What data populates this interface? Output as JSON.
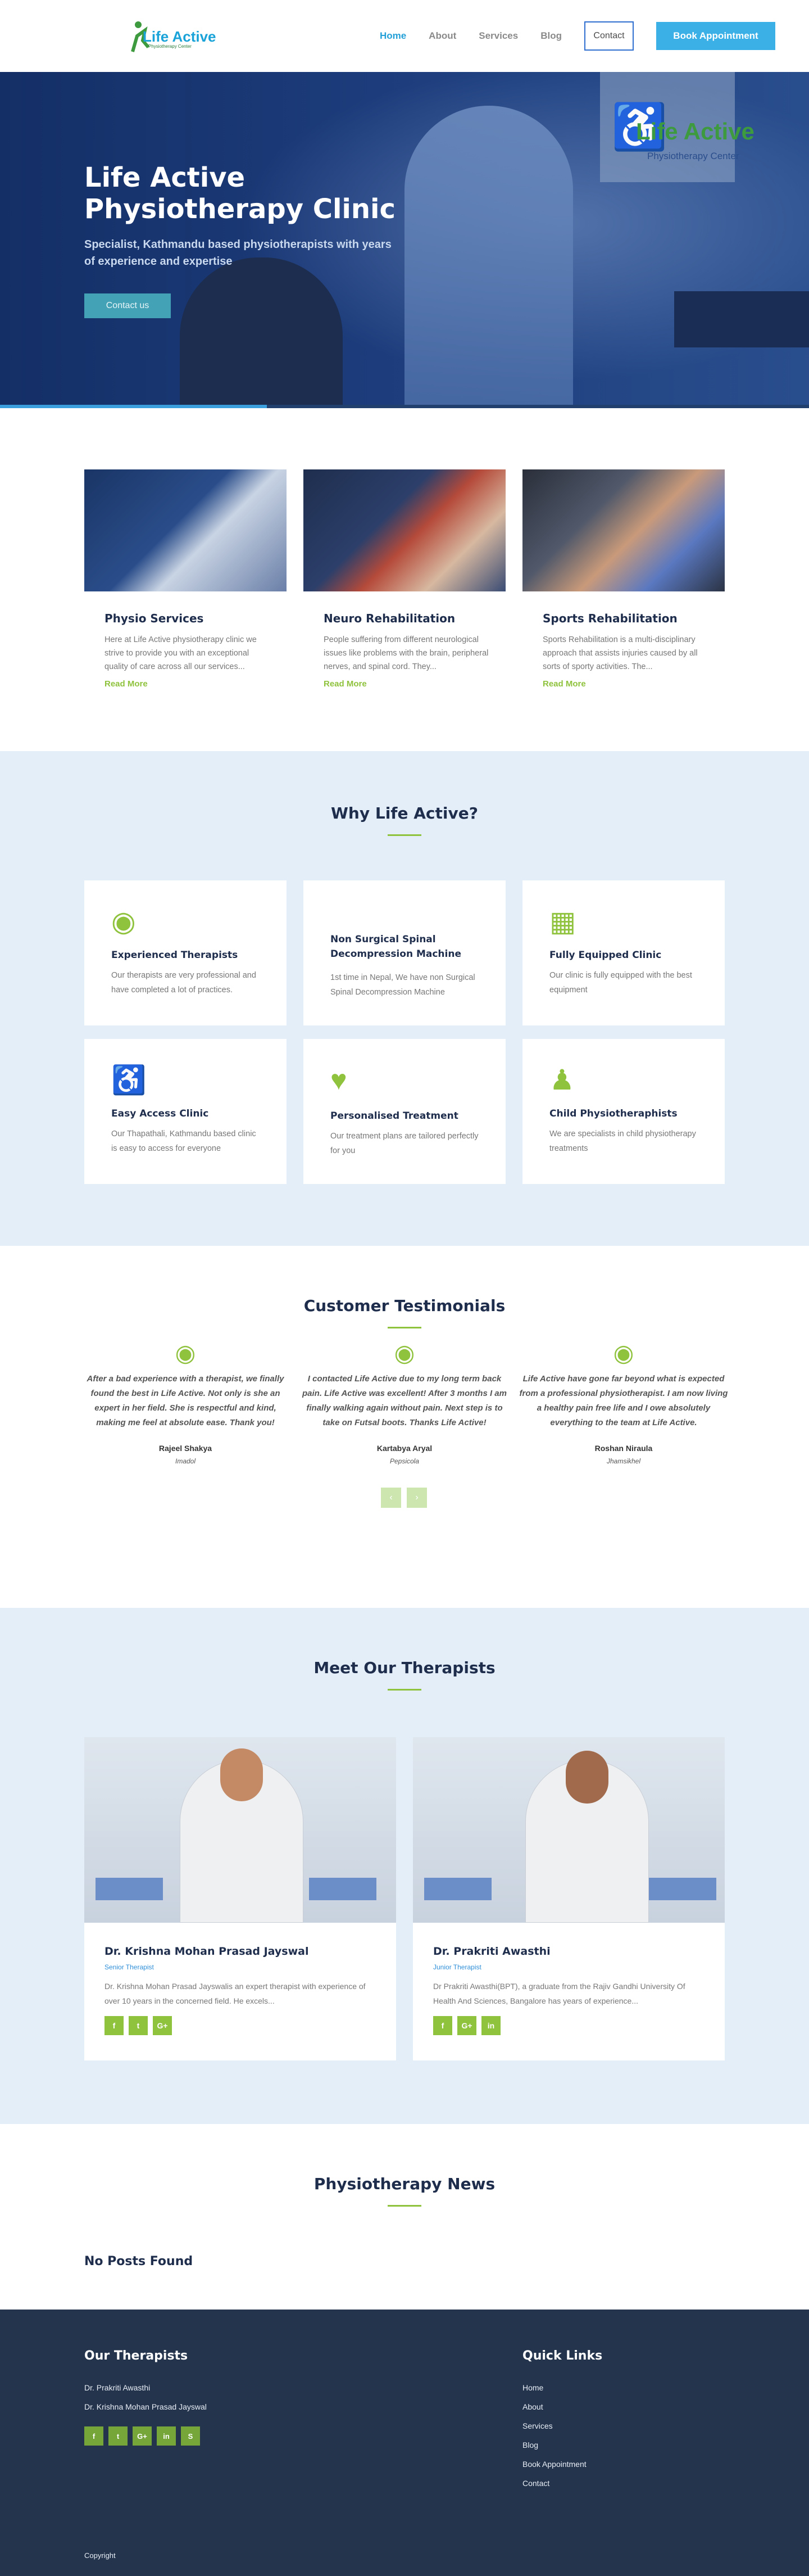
{
  "header": {
    "logo_brand": "Life Active",
    "logo_tagline": "Physiotherapy Center",
    "nav": [
      "Home",
      "About",
      "Services",
      "Blog"
    ],
    "contact_label": "Contact",
    "book_label": "Book Appointment"
  },
  "hero": {
    "title": "Life Active Physiotherapy Clinic",
    "subtitle": "Specialist, Kathmandu based physiotherapists with years of experience and expertise",
    "button": "Contact us",
    "sign_brand": "Life Active",
    "sign_tagline": "Physiotherapy Center",
    "slide_progress": 0.33
  },
  "services": [
    {
      "title": "Physio Services",
      "text": "Here at Life Active physiotherapy clinic we strive to provide you with an exceptional quality of care across all our services...",
      "more": "Read More"
    },
    {
      "title": "Neuro Rehabilitation",
      "text": "People suffering from different neurological issues like problems with the brain, peripheral nerves, and spinal cord. They...",
      "more": "Read More"
    },
    {
      "title": "Sports Rehabilitation",
      "text": "Sports Rehabilitation is a multi-disciplinary approach that assists injuries caused by all sorts of sporty activities. The...",
      "more": "Read More"
    }
  ],
  "why": {
    "title": "Why Life Active?",
    "cards": [
      {
        "icon": "user-circle-icon",
        "title": "Experienced Therapists",
        "text": "Our therapists are very professional and have completed a lot of practices."
      },
      {
        "icon": "",
        "title": "Non Surgical Spinal Decompression Machine",
        "text": "1st time in Nepal, We have non Surgical Spinal Decompression Machine"
      },
      {
        "icon": "building-icon",
        "title": "Fully Equipped Clinic",
        "text": "Our clinic is fully equipped with the best equipment"
      },
      {
        "icon": "wheelchair-icon",
        "title": "Easy Access Clinic",
        "text": "Our Thapathali, Kathmandu based clinic is easy to access for everyone"
      },
      {
        "icon": "heartbeat-icon",
        "title": "Personalised Treatment",
        "text": "Our treatment plans are tailored perfectly for you"
      },
      {
        "icon": "child-icon",
        "title": "Child Physiotheraphists",
        "text": "We are specialists in child physiotherapy treatments"
      }
    ]
  },
  "testimonials": {
    "title": "Customer Testimonials",
    "items": [
      {
        "quote": "After a bad experience with a therapist, we finally found the best in Life Active. Not only is she an expert in her field. She is respectful and kind, making me feel at absolute ease. Thank you!",
        "name": "Rajeel Shakya",
        "location": "Imadol"
      },
      {
        "quote": "I contacted Life Active due to my long term back pain. Life Active was excellent! After 3 months I am finally walking again without pain. Next step is to take on Futsal boots. Thanks Life Active!",
        "name": "Kartabya Aryal",
        "location": "Pepsicola"
      },
      {
        "quote": "Life Active have gone far beyond what is expected from a professional physiotherapist. I am now living a healthy pain free life and I owe absolutely everything to the team at Life Active.",
        "name": "Roshan Niraula",
        "location": "Jhamsikhel"
      }
    ],
    "prev": "‹",
    "next": "›"
  },
  "therapists": {
    "title": "Meet Our Therapists",
    "items": [
      {
        "name": "Dr. Krishna Mohan Prasad Jayswal",
        "role": "Senior Therapist",
        "text": "Dr. Krishna Mohan Prasad Jayswalis an expert therapist with experience of over 10 years in the concerned field. He excels...",
        "socials": [
          "f",
          "t",
          "G+"
        ]
      },
      {
        "name": "Dr. Prakriti Awasthi",
        "role": "Junior Therapist",
        "text": "Dr Prakriti Awasthi(BPT), a graduate from the Rajiv Gandhi University Of Health And Sciences, Bangalore has years of experience...",
        "socials": [
          "f",
          "G+",
          "in"
        ]
      }
    ]
  },
  "news": {
    "title": "Physiotherapy News",
    "empty": "No Posts Found"
  },
  "footer": {
    "therapists_title": "Our Therapists",
    "therapists": [
      "Dr. Prakriti Awasthi",
      "Dr. Krishna Mohan Prasad Jayswal"
    ],
    "socials": [
      "f",
      "t",
      "G+",
      "in",
      "S"
    ],
    "links_title": "Quick Links",
    "links": [
      "Home",
      "About",
      "Services",
      "Blog",
      "Book Appointment",
      "Contact"
    ],
    "copyright": "Copyright"
  },
  "colors": {
    "primary": "#24a0d8",
    "accent": "#8fc23d",
    "dark": "#24344d",
    "light_bg": "#e4eef9"
  }
}
